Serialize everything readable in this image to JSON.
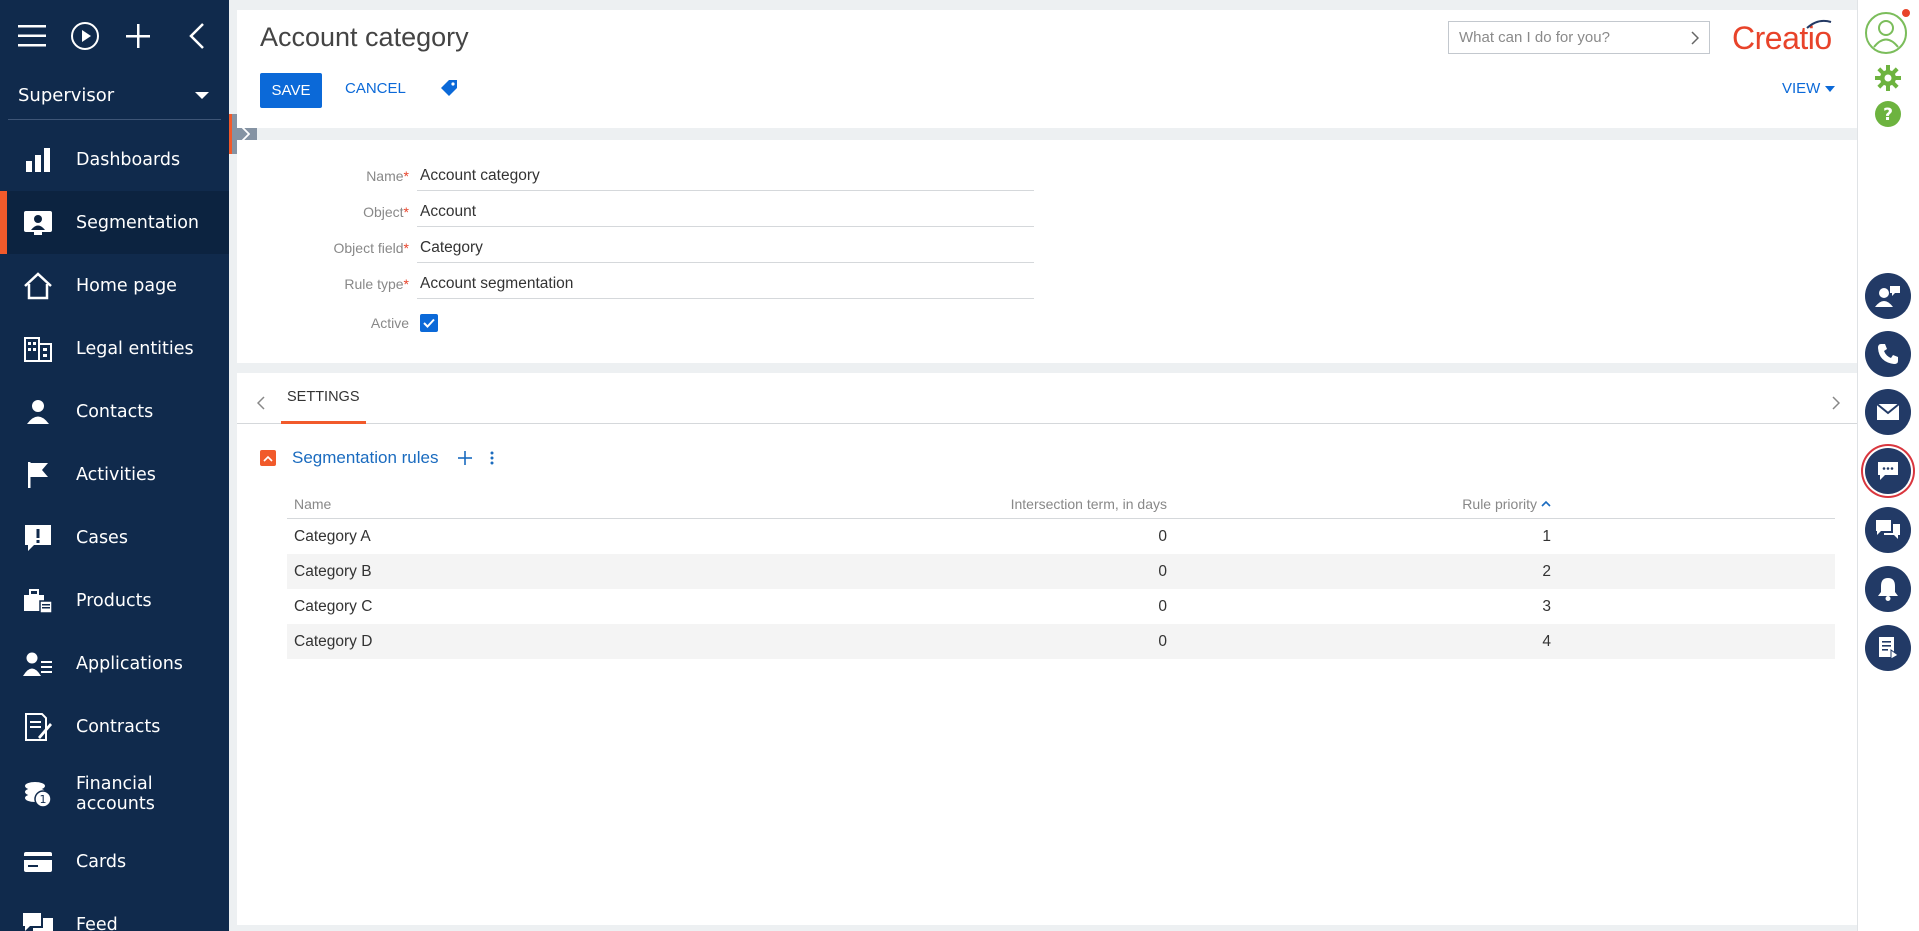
{
  "sidebar": {
    "role": "Supervisor",
    "items": [
      {
        "label": "Dashboards",
        "icon": "dashboards-icon"
      },
      {
        "label": "Segmentation",
        "icon": "segmentation-icon"
      },
      {
        "label": "Home page",
        "icon": "home-icon"
      },
      {
        "label": "Legal entities",
        "icon": "building-icon"
      },
      {
        "label": "Contacts",
        "icon": "contact-icon"
      },
      {
        "label": "Activities",
        "icon": "flag-icon"
      },
      {
        "label": "Cases",
        "icon": "cases-icon"
      },
      {
        "label": "Products",
        "icon": "products-icon"
      },
      {
        "label": "Applications",
        "icon": "applications-icon"
      },
      {
        "label": "Contracts",
        "icon": "contracts-icon"
      },
      {
        "label": "Financial accounts",
        "icon": "financial-icon"
      },
      {
        "label": "Cards",
        "icon": "card-icon"
      },
      {
        "label": "Feed",
        "icon": "feed-icon"
      }
    ]
  },
  "header": {
    "title": "Account category",
    "save_label": "SAVE",
    "cancel_label": "CANCEL",
    "search_placeholder": "What can I do for you?",
    "logo_text": "Creatio",
    "view_label": "VIEW"
  },
  "form": {
    "fields": [
      {
        "label": "Name",
        "value": "Account category",
        "required": true
      },
      {
        "label": "Object",
        "value": "Account",
        "required": true
      },
      {
        "label": "Object field",
        "value": "Category",
        "required": true
      },
      {
        "label": "Rule type",
        "value": "Account segmentation",
        "required": true
      }
    ],
    "active_label": "Active",
    "active_checked": true
  },
  "details": {
    "tab_label": "SETTINGS",
    "group_title": "Segmentation rules",
    "columns": [
      "Name",
      "Intersection term, in days",
      "Rule priority"
    ],
    "rows": [
      {
        "name": "Category A",
        "term": "0",
        "priority": "1"
      },
      {
        "name": "Category B",
        "term": "0",
        "priority": "2"
      },
      {
        "name": "Category C",
        "term": "0",
        "priority": "3"
      },
      {
        "name": "Category D",
        "term": "0",
        "priority": "4"
      }
    ]
  },
  "colors": {
    "sidebar_bg": "#102a4c",
    "accent": "#f15a2b",
    "primary": "#0b69d8"
  }
}
